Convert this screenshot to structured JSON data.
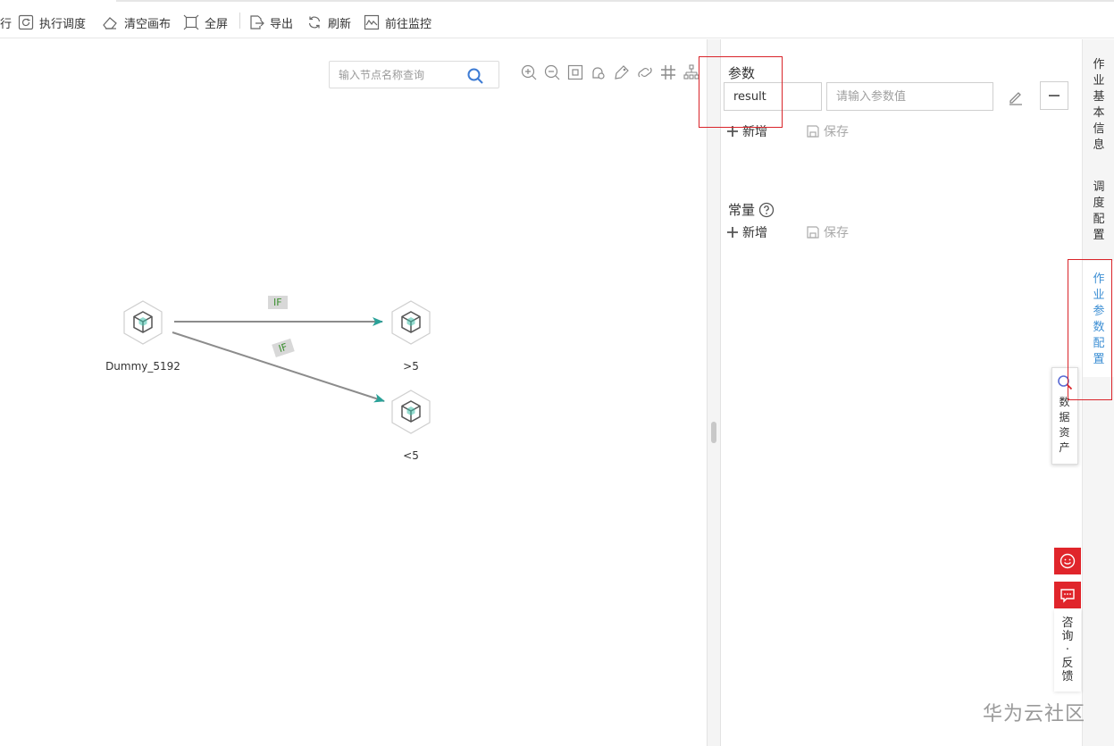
{
  "toolbar": {
    "partial_label": "行",
    "execute_schedule": "执行调度",
    "clear_canvas": "清空画布",
    "fullscreen": "全屏",
    "export": "导出",
    "refresh": "刷新",
    "goto_monitor": "前往监控"
  },
  "canvas": {
    "search_placeholder": "输入节点名称查询",
    "controls": [
      "zoom-in-icon",
      "zoom-out-icon",
      "fit-screen-icon",
      "lock-icon",
      "tag-icon",
      "link-icon",
      "grid-icon",
      "layout-icon"
    ],
    "nodes": [
      {
        "label": "Dummy_5192"
      },
      {
        "label": ">5"
      },
      {
        "label": "<5"
      }
    ],
    "edges": [
      {
        "label": "IF"
      },
      {
        "label": "IF"
      }
    ],
    "colors": {
      "edge": "#8c8c8c",
      "arrow": "#2aa198",
      "node_accent": "#3fbfaa"
    }
  },
  "panel": {
    "params_title": "参数",
    "param_name_value": "result",
    "param_value_placeholder": "请输入参数值",
    "add_label": "新增",
    "save_label": "保存",
    "constants_title": "常量",
    "constants_add_label": "新增",
    "constants_save_label": "保存"
  },
  "side_tabs": [
    {
      "label": "作业基本信息",
      "active": false
    },
    {
      "label": "调度配置",
      "active": false
    },
    {
      "label": "作业参数配置",
      "active": true
    }
  ],
  "floating": {
    "data_assets": "数据资产",
    "consult_feedback": "咨询·反馈"
  },
  "watermark": "华为云社区",
  "colors": {
    "accent_blue": "#3d8fd4",
    "highlight_red": "#d9242a",
    "feedback_red": "#e0252b"
  }
}
